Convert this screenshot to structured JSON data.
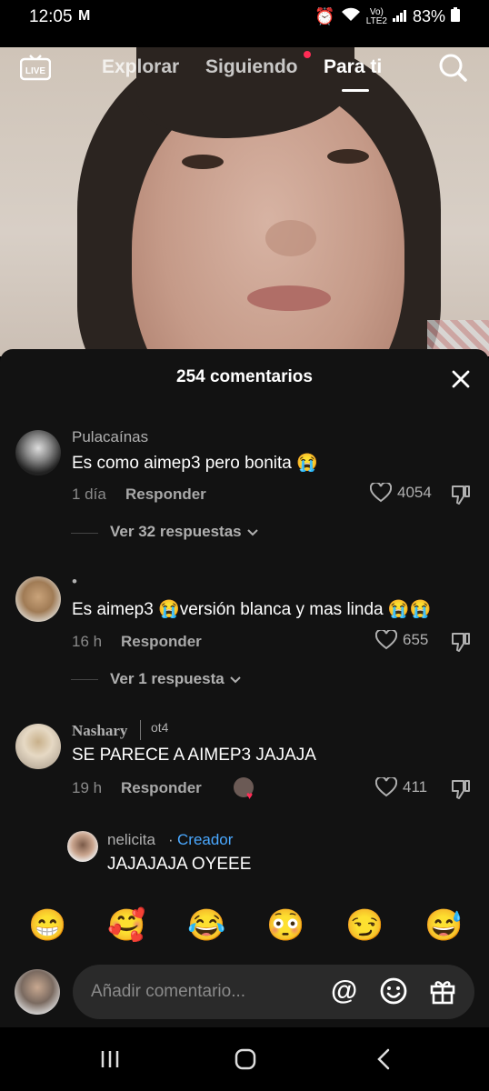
{
  "status": {
    "time": "12:05",
    "mail": "M",
    "net_top": "Vo)",
    "net_bottom": "LTE2",
    "battery": "83%"
  },
  "topnav": {
    "live": "LIVE",
    "tabs": [
      {
        "label": "Explorar"
      },
      {
        "label": "Siguiendo"
      },
      {
        "label": "Para ti"
      }
    ]
  },
  "sheet": {
    "title": "254 comentarios",
    "comments": [
      {
        "user": "Pulacaínas",
        "text": "Es como aimep3 pero bonita 😭",
        "time": "1 día",
        "reply": "Responder",
        "likes": "4054",
        "view_replies": "Ver 32 respuestas"
      },
      {
        "user": "•",
        "text": "Es aimep3 😭versión blanca y mas linda 😭😭",
        "time": "16 h",
        "reply": "Responder",
        "likes": "655",
        "view_replies": "Ver 1 respuesta"
      },
      {
        "user": "Nashary",
        "user_extra": "ot4",
        "text": "SE PARECE A AIMEP3 JAJAJA",
        "time": "19 h",
        "reply": "Responder",
        "likes": "411"
      },
      {
        "user": "nelicita",
        "creator": "Creador",
        "dot": "·",
        "text": "JAJAJAJA OYEEE"
      }
    ]
  },
  "emojis": [
    "😁",
    "🥰",
    "😂",
    "😳",
    "😏",
    "😅"
  ],
  "input": {
    "placeholder": "Añadir comentario...",
    "at": "@"
  },
  "colors": {
    "accent": "#fe2c55",
    "creator": "#4aa8ff",
    "sheet_bg": "#121212"
  }
}
